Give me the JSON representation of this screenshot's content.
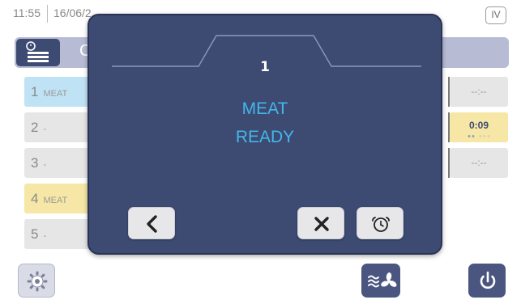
{
  "status": {
    "time": "11:55",
    "date": "16/06/2",
    "level": "IV"
  },
  "header": {
    "fragment": "C"
  },
  "slots": [
    {
      "number": "1",
      "label": "MEAT",
      "color": "#bfe3f5"
    },
    {
      "number": "2",
      "label": "-",
      "color": "#e6e6e6"
    },
    {
      "number": "3",
      "label": "-",
      "color": "#e6e6e6"
    },
    {
      "number": "4",
      "label": "MEAT",
      "color": "#f6e7a6"
    },
    {
      "number": "5",
      "label": "-",
      "color": "#e6e6e6"
    }
  ],
  "timers": [
    {
      "value": "--:--",
      "color": "#e6e6e6"
    },
    {
      "value": "0:09",
      "color": "#f6e7a6"
    },
    {
      "value": "--:--",
      "color": "#e6e6e6"
    }
  ],
  "modal": {
    "slot_number": "1",
    "message_line1": "MEAT",
    "message_line2": "READY",
    "buttons": {
      "back": "chevron-left-icon",
      "dismiss": "close-icon",
      "timer": "alarm-clock-icon"
    }
  },
  "bottom_bar": {
    "settings": "gear-icon",
    "fan": "fan-icon",
    "power": "power-icon"
  },
  "colors": {
    "modal_bg": "#3d4a72",
    "message": "#43b7e9",
    "header": "#b7bcd4",
    "selected_slot": "#bfe3f5",
    "ready_slot": "#f6e7a6"
  }
}
